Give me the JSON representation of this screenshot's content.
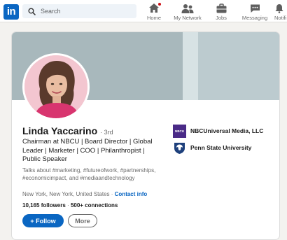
{
  "nav": {
    "logo_text": "in",
    "search_placeholder": "Search",
    "items": [
      {
        "label": "Home",
        "icon": "home-icon",
        "notification": true
      },
      {
        "label": "My Network",
        "icon": "network-icon"
      },
      {
        "label": "Jobs",
        "icon": "jobs-icon"
      },
      {
        "label": "Messaging",
        "icon": "messaging-icon"
      },
      {
        "label": "Notifi",
        "icon": "notifications-icon"
      }
    ]
  },
  "profile": {
    "name": "Linda Yaccarino",
    "degree": "· 3rd",
    "headline": "Chairman at NBCU | Board Director | Global Leader | Marketer | COO | Philanthropist | Public Speaker",
    "about": "Talks about #marketing, #futureofwork, #partnerships, #economicimpact, and #mediaandtechnology",
    "location": "New York, New York, United States",
    "location_separator": "·",
    "contact_label": "Contact info",
    "followers": "10,165 followers",
    "connections_separator": "·",
    "connections": "500+ connections",
    "follow_label": "+ Follow",
    "more_label": "More"
  },
  "organizations": [
    {
      "name": "NBCUniversal Media, LLC",
      "logo_text": "NBCU",
      "icon": "nbcu-logo"
    },
    {
      "name": "Penn State University",
      "icon": "penn-state-logo"
    }
  ],
  "colors": {
    "brand": "#0a66c2",
    "banner": "#a8b8bc",
    "nbcu_purple": "#4a2a87",
    "notification_red": "#cc1016"
  }
}
